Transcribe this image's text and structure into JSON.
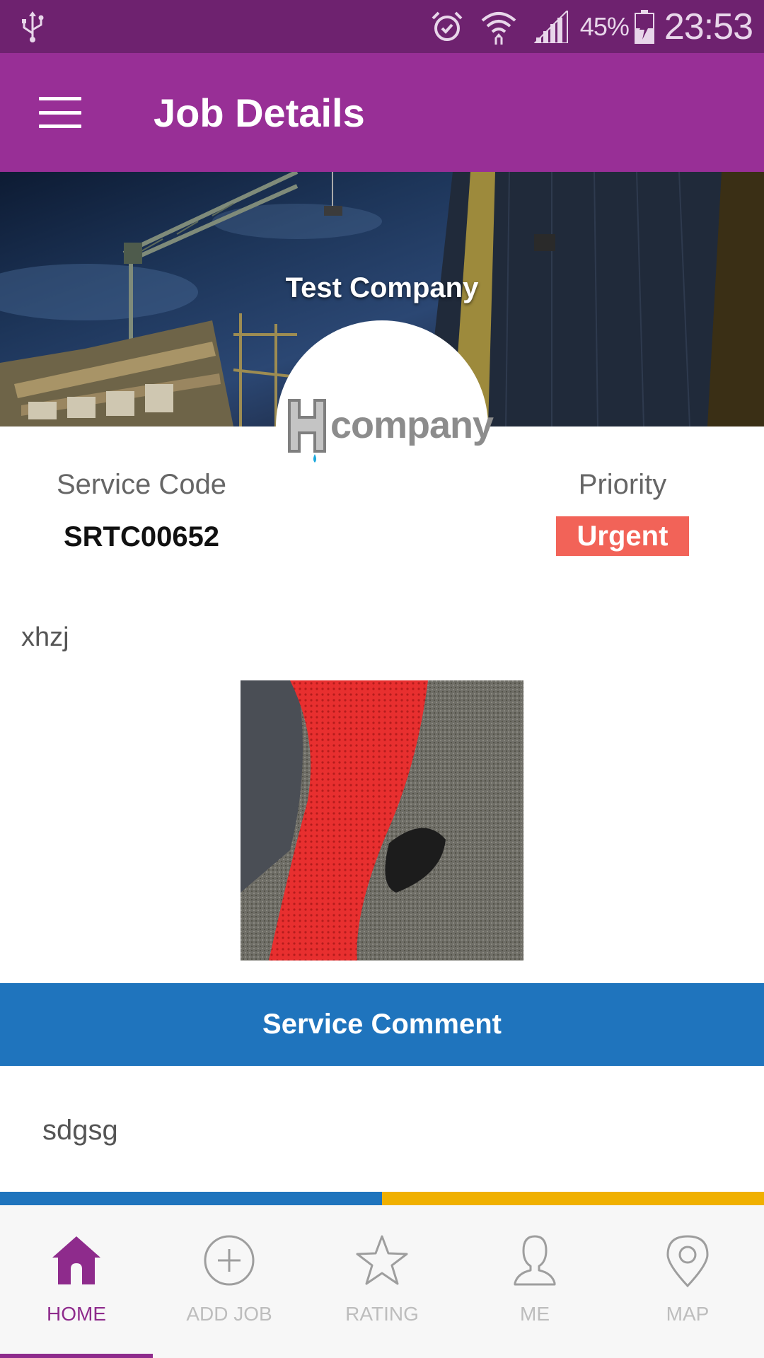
{
  "status_bar": {
    "battery_percent": "45%",
    "time": "23:53",
    "icons": [
      "usb-icon",
      "alarm-icon",
      "wifi-icon",
      "signal-icon",
      "battery-charging-icon"
    ]
  },
  "app_bar": {
    "title": "Job Details",
    "menu_icon": "hamburger-menu-icon"
  },
  "banner": {
    "company_name": "Test Company",
    "logo_text": "company"
  },
  "job": {
    "service_code_label": "Service Code",
    "service_code": "SRTC00652",
    "priority_label": "Priority",
    "priority": "Urgent",
    "description": "xhzj"
  },
  "comment": {
    "header": "Service Comment",
    "text": "sdgsg"
  },
  "nav": {
    "items": [
      {
        "label": "HOME",
        "icon": "home-icon",
        "active": true
      },
      {
        "label": "ADD JOB",
        "icon": "add-circle-icon",
        "active": false
      },
      {
        "label": "RATING",
        "icon": "star-icon",
        "active": false
      },
      {
        "label": "ME",
        "icon": "person-icon",
        "active": false
      },
      {
        "label": "MAP",
        "icon": "map-pin-icon",
        "active": false
      }
    ]
  },
  "colors": {
    "status_bar": "#6e226f",
    "app_bar": "#982f96",
    "priority_badge": "#f26358",
    "comment_header": "#1f74bd",
    "strip_yellow": "#f0b000",
    "nav_active": "#8e2b8c"
  }
}
